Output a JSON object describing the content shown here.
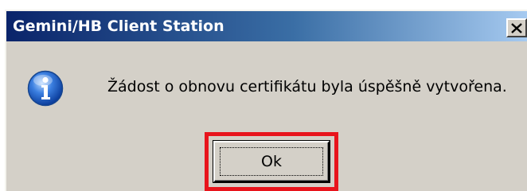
{
  "window": {
    "title": "Gemini/HB Client Station",
    "close_label": "Close"
  },
  "dialog": {
    "icon": "info-icon",
    "message": "Žádost o obnovu certifikátu byla úspěšně vytvořena.",
    "ok_label": "Ok"
  },
  "colors": {
    "titlebar_start": "#0a246a",
    "titlebar_end": "#a6caf0",
    "dialog_bg": "#d4d0c8",
    "highlight": "#e8141c"
  }
}
